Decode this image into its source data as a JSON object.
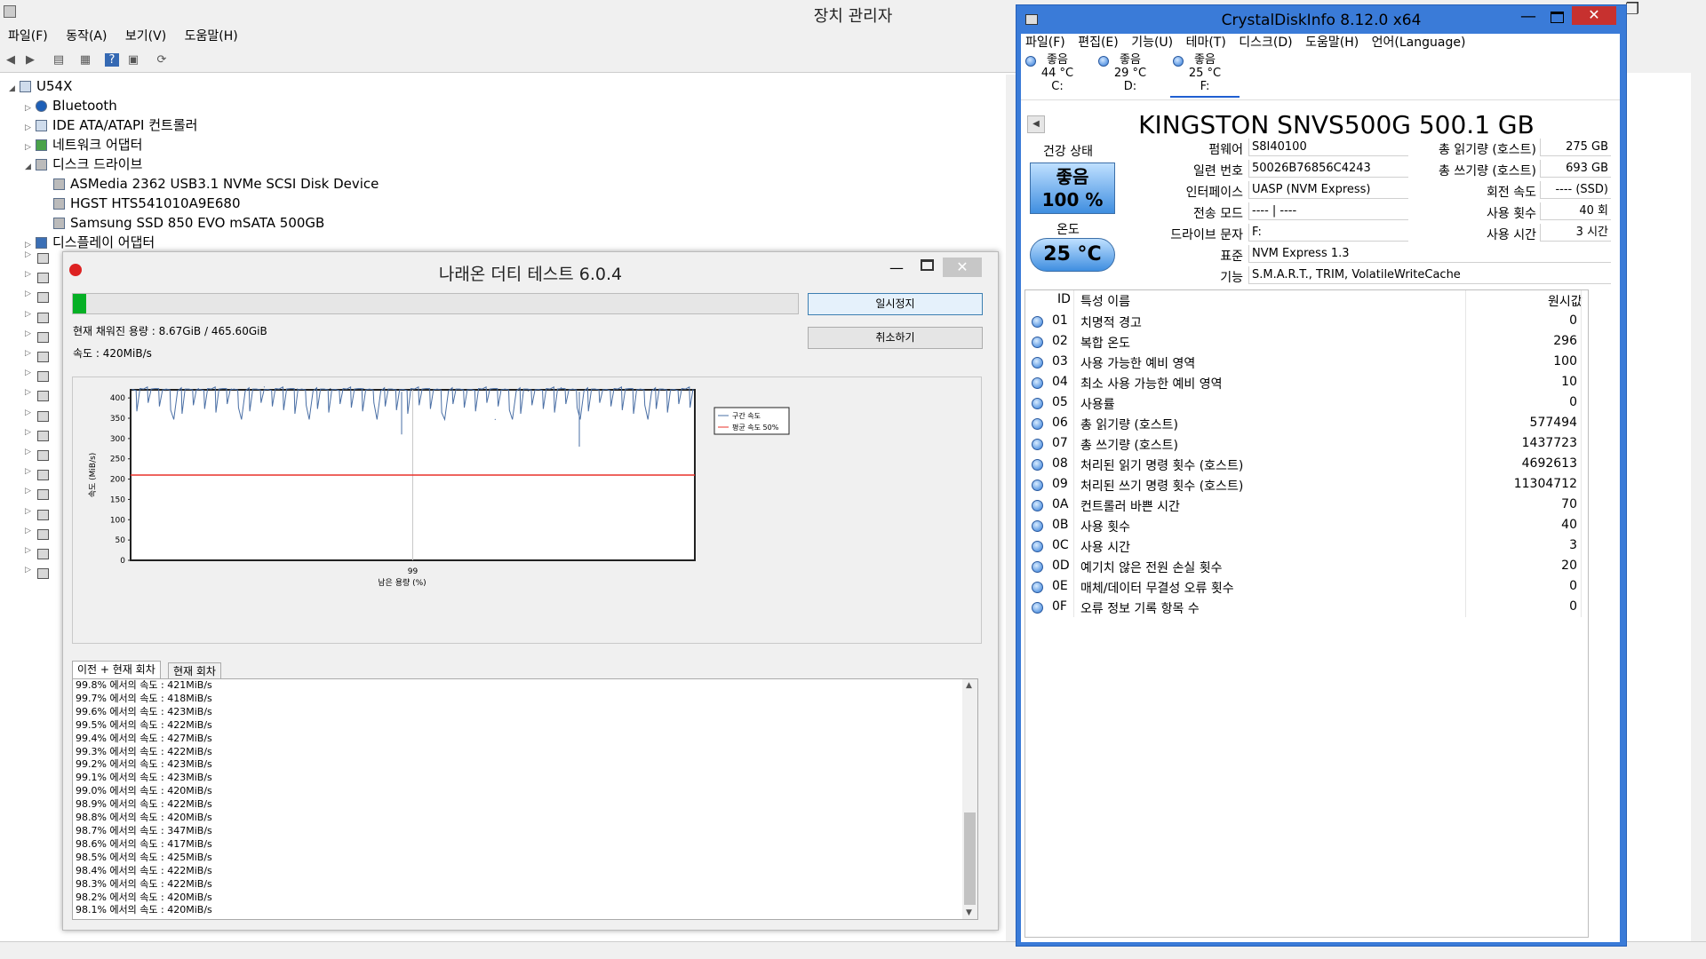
{
  "devmgr": {
    "title": "장치 관리자",
    "menu": [
      "파일(F)",
      "동작(A)",
      "보기(V)",
      "도움말(H)"
    ],
    "root": "U54X",
    "nodes": [
      "Bluetooth",
      "IDE ATA/ATAPI 컨트롤러",
      "네트워크 어댑터",
      "디스크 드라이브"
    ],
    "disks": [
      "ASMedia 2362 USB3.1 NVMe SCSI Disk Device",
      "HGST HTS541010A9E680",
      "Samsung SSD 850 EVO mSATA 500GB"
    ],
    "display": "디스플레이 어댑터",
    "collapsed_icons": [
      "camera-icon",
      "monitor-icon",
      "network-icon",
      "mouse-icon",
      "audio-icon",
      "battery-icon",
      "computer-icon",
      "speaker-icon",
      "storage-icon",
      "printer-icon",
      "usb-icon",
      "monitor-icon",
      "keyboard-icon",
      "processor-icon",
      "printer-icon",
      "system-icon",
      "hid-icon"
    ]
  },
  "naraeon": {
    "title": "나래온 더티 테스트 6.0.4",
    "progress": 0.0186,
    "filled_label": "현재 채워진 용량 : 8.67GiB / 465.60GiB",
    "speed_label": "속도 : 420MiB/s",
    "pause_label": "일시정지",
    "cancel_label": "취소하기",
    "tabs": [
      "이전 + 현재 회차",
      "현재 회차"
    ],
    "log": [
      "99.8% 에서의 속도 : 421MiB/s",
      "99.7% 에서의 속도 : 418MiB/s",
      "99.6% 에서의 속도 : 423MiB/s",
      "99.5% 에서의 속도 : 422MiB/s",
      "99.4% 에서의 속도 : 427MiB/s",
      "99.3% 에서의 속도 : 422MiB/s",
      "99.2% 에서의 속도 : 423MiB/s",
      "99.1% 에서의 속도 : 423MiB/s",
      "99.0% 에서의 속도 : 420MiB/s",
      "98.9% 에서의 속도 : 422MiB/s",
      "98.8% 에서의 속도 : 420MiB/s",
      "98.7% 에서의 속도 : 347MiB/s",
      "98.6% 에서의 속도 : 417MiB/s",
      "98.5% 에서의 속도 : 425MiB/s",
      "98.4% 에서의 속도 : 422MiB/s",
      "98.3% 에서의 속도 : 422MiB/s",
      "98.2% 에서의 속도 : 420MiB/s",
      "98.1% 에서의 속도 : 420MiB/s"
    ]
  },
  "chart_data": {
    "type": "line",
    "title": "",
    "xlabel": "남은 용량 (%)",
    "ylabel": "속도 (MiB/s)",
    "ylim": [
      0,
      420
    ],
    "yticks": [
      0,
      50,
      100,
      150,
      200,
      250,
      300,
      350,
      400
    ],
    "xticks": [
      "99"
    ],
    "grid": true,
    "legend_position": "top-right",
    "series": [
      {
        "name": "구간 속도",
        "color": "#4a6fa5",
        "values": [
          421,
          418,
          423,
          422,
          427,
          422,
          423,
          423,
          420,
          422,
          420,
          347,
          417,
          425,
          422,
          422,
          420,
          420
        ]
      },
      {
        "name": "평균 속도 50%",
        "color": "#e8302a",
        "values": [
          210
        ]
      }
    ]
  },
  "cdi": {
    "title": "CrystalDiskInfo 8.12.0 x64",
    "menu": [
      "파일(F)",
      "편집(E)",
      "기능(U)",
      "테마(T)",
      "디스크(D)",
      "도움말(H)",
      "언어(Language)"
    ],
    "drives": [
      {
        "status": "좋음",
        "temp": "44 °C",
        "letter": "C:"
      },
      {
        "status": "좋음",
        "temp": "29 °C",
        "letter": "D:"
      },
      {
        "status": "좋음",
        "temp": "25 °C",
        "letter": "F:"
      }
    ],
    "model": "KINGSTON SNVS500G 500.1 GB",
    "health_label": "건강 상태",
    "health_status": "좋음",
    "health_pct": "100 %",
    "temp_label": "온도",
    "temp": "25 °C",
    "firmware_label": "펌웨어",
    "firmware": "S8I40100",
    "serial_label": "일련 번호",
    "serial": "50026B76856C4243",
    "interface_label": "인터페이스",
    "interface": "UASP (NVM Express)",
    "transfer_label": "전송 모드",
    "transfer": "---- | ----",
    "letter_label": "드라이브 문자",
    "letter": "F:",
    "standard_label": "표준",
    "standard": "NVM Express 1.3",
    "features_label": "기능",
    "features": "S.M.A.R.T., TRIM, VolatileWriteCache",
    "reads_label": "총 읽기량 (호스트)",
    "reads": "275 GB",
    "writes_label": "총 쓰기량 (호스트)",
    "writes": "693 GB",
    "rpm_label": "회전 속도",
    "rpm": "---- (SSD)",
    "count_label": "사용 횟수",
    "count": "40 회",
    "hours_label": "사용 시간",
    "hours": "3 시간",
    "table_headers": [
      "ID",
      "특성 이름",
      "원시값"
    ],
    "attributes": [
      {
        "id": "01",
        "name": "치명적 경고",
        "raw": "0"
      },
      {
        "id": "02",
        "name": "복합 온도",
        "raw": "296"
      },
      {
        "id": "03",
        "name": "사용 가능한 예비 영역",
        "raw": "100"
      },
      {
        "id": "04",
        "name": "최소 사용 가능한 예비 영역",
        "raw": "10"
      },
      {
        "id": "05",
        "name": "사용률",
        "raw": "0"
      },
      {
        "id": "06",
        "name": "총 읽기량 (호스트)",
        "raw": "577494"
      },
      {
        "id": "07",
        "name": "총 쓰기량 (호스트)",
        "raw": "1437723"
      },
      {
        "id": "08",
        "name": "처리된 읽기 명령 횟수 (호스트)",
        "raw": "4692613"
      },
      {
        "id": "09",
        "name": "처리된 쓰기 명령 횟수 (호스트)",
        "raw": "11304712"
      },
      {
        "id": "0A",
        "name": "컨트롤러 바쁜 시간",
        "raw": "70"
      },
      {
        "id": "0B",
        "name": "사용 횟수",
        "raw": "40"
      },
      {
        "id": "0C",
        "name": "사용 시간",
        "raw": "3"
      },
      {
        "id": "0D",
        "name": "예기치 않은 전원 손실 횟수",
        "raw": "20"
      },
      {
        "id": "0E",
        "name": "매체/데이터 무결성 오류 횟수",
        "raw": "0"
      },
      {
        "id": "0F",
        "name": "오류 정보 기록 항목 수",
        "raw": "0"
      }
    ]
  }
}
